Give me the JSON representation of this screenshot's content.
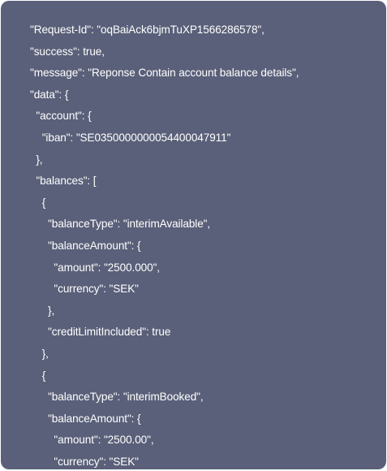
{
  "code_block": {
    "lines": [
      "\"Request-Id\": \"oqBaiAck6bjmTuXP1566286578\",",
      "\"success\": true,",
      "\"message\": \"Reponse Contain account balance details\",",
      "\"data\": {",
      "  \"account\": {",
      "    \"iban\": \"SE0350000000054400047911\"",
      "  },",
      "  \"balances\": [",
      "    {",
      "      \"balanceType\": \"interimAvailable\",",
      "      \"balanceAmount\": {",
      "        \"amount\": \"2500.000\",",
      "        \"currency\": \"SEK\"",
      "      },",
      "      \"creditLimitIncluded\": true",
      "    },",
      "    {",
      "      \"balanceType\": \"interimBooked\",",
      "      \"balanceAmount\": {",
      "        \"amount\": \"2500.00\",",
      "        \"currency\": \"SEK\""
    ]
  }
}
